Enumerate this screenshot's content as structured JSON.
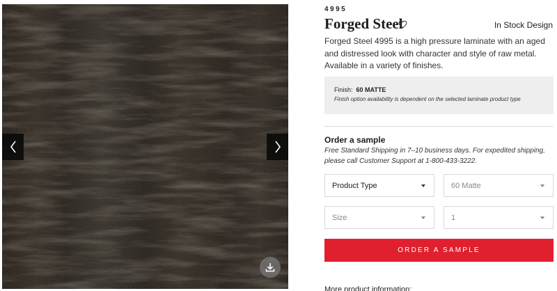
{
  "product": {
    "sku": "4995",
    "name": "Forged Steel",
    "availability": "In Stock Design",
    "description": "Forged Steel 4995 is a high pressure laminate with an aged and distressed look with character and style of raw metal. Available in a variety of finishes."
  },
  "finish": {
    "label": "Finish:",
    "value": "60 MATTE",
    "note": "Finish option availability is dependent on the selected laminate product type"
  },
  "order": {
    "heading": "Order a sample",
    "shipping_note": "Free Standard Shipping in 7–10 business days. For expedited shipping, please call Customer Support at 1-800-433-3222.",
    "product_type": "Product Type",
    "finish_select": "60 Matte",
    "size": "Size",
    "quantity": "1",
    "button": "ORDER A SAMPLE"
  },
  "more_info": "More product information:",
  "icons": {
    "prev": "chevron-left-icon",
    "next": "chevron-right-icon",
    "favorite": "heart-icon",
    "download": "download-icon"
  },
  "colors": {
    "accent": "#e0202e",
    "finish_box": "#eeeeee"
  }
}
